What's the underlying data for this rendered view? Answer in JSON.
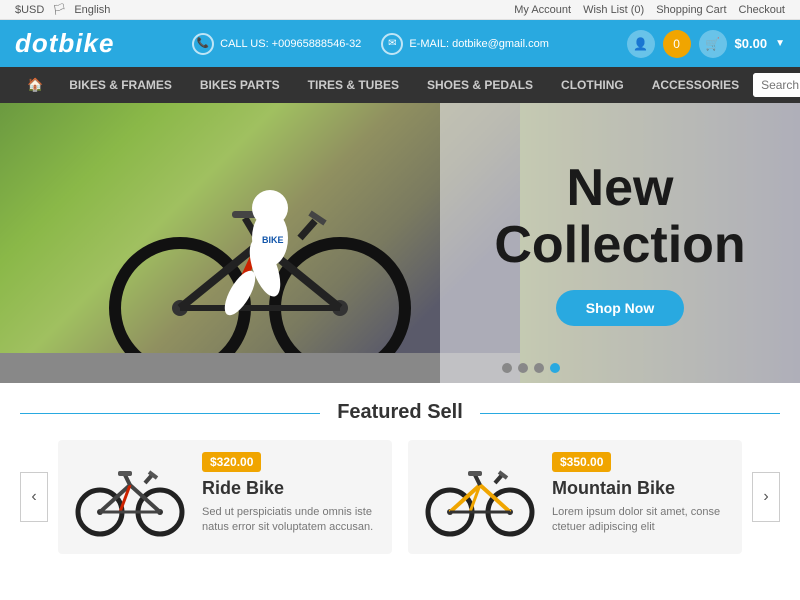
{
  "topbar": {
    "currency": "$USD",
    "language": "English",
    "links": [
      "My Account",
      "Wish List (0)",
      "Shopping Cart",
      "Checkout"
    ]
  },
  "header": {
    "logo": "dotbike",
    "phone_label": "CALL US: +00965888546-32",
    "email_label": "E-MAIL: dotbike@gmail.com",
    "cart_total": "$0.00",
    "cart_count": "0"
  },
  "nav": {
    "items": [
      "BIKES & FRAMES",
      "BIKES PARTS",
      "TIRES & TUBES",
      "SHOES & PEDALS",
      "CLOTHING",
      "ACCESSORIES"
    ],
    "search_placeholder": "Search"
  },
  "hero": {
    "title_line1": "New",
    "title_line2": "Collection",
    "cta_label": "Shop Now",
    "dots": [
      1,
      2,
      3,
      4
    ],
    "active_dot": 4
  },
  "featured": {
    "section_title": "Featured Sell",
    "products": [
      {
        "name": "Ride Bike",
        "price": "$320.00",
        "description": "Sed ut perspiciatis unde omnis iste natus error sit voluptatem accusan."
      },
      {
        "name": "Mountain Bike",
        "price": "$350.00",
        "description": "Lorem ipsum dolor sit amet, conse ctetuer adipiscing elit"
      }
    ]
  }
}
